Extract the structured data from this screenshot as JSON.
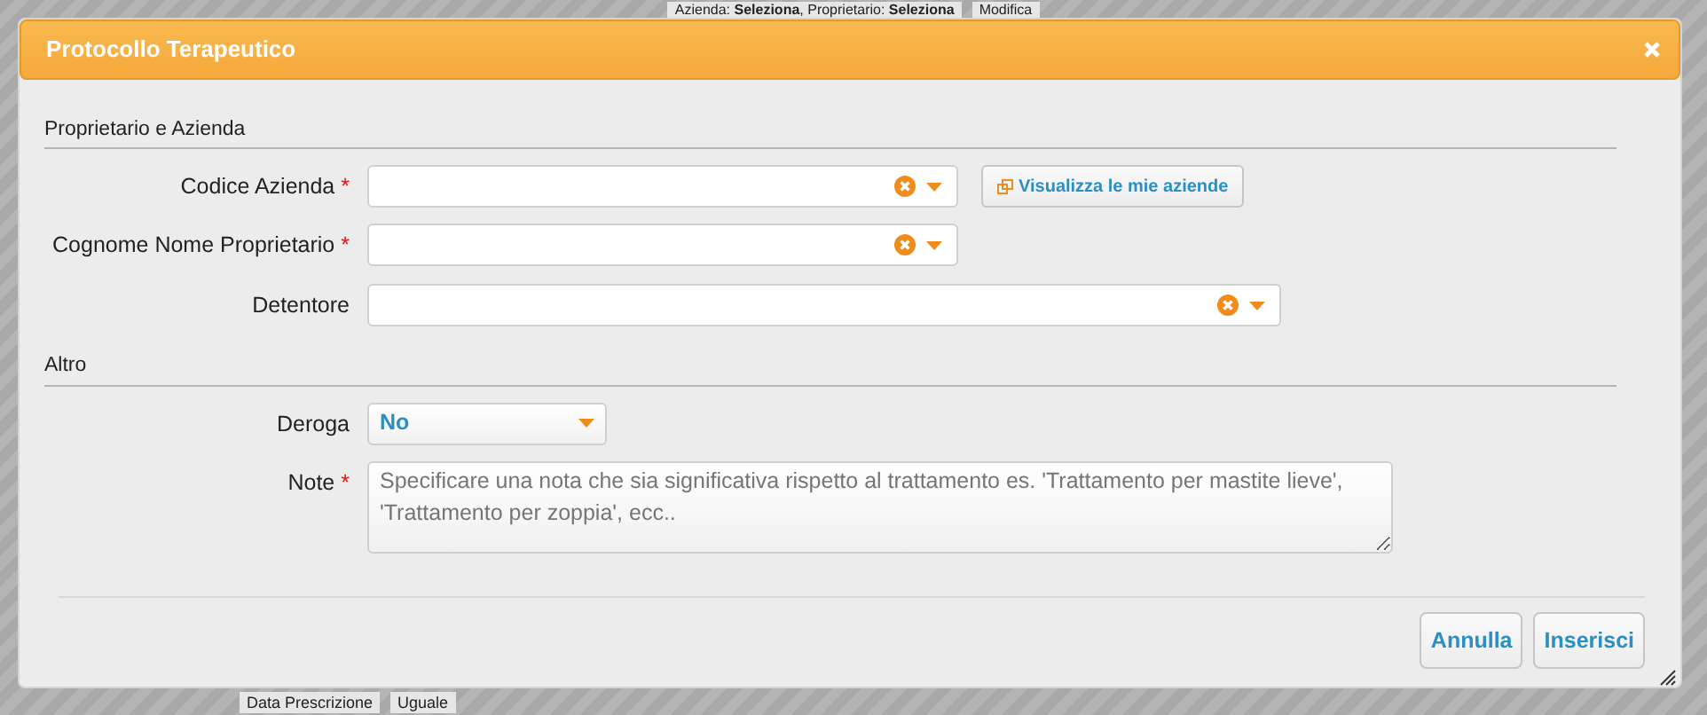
{
  "background_page": {
    "summary": "Azienda: **Seleziona**, Proprietario: **Seleziona**",
    "edit_link": "Modifica",
    "filter_label": "Data Prescrizione",
    "filter_value": "Uguale"
  },
  "dialog": {
    "title": "Protocollo Terapeutico",
    "sections": [
      {
        "title": "Proprietario e Azienda",
        "fields": [
          {
            "kind": "combo",
            "label": "Codice Azienda",
            "required_mark": "*",
            "action_button": "Visualizza le mie aziende"
          },
          {
            "kind": "combo",
            "label": "Cognome Nome Proprietario",
            "required_mark": "*"
          },
          {
            "kind": "combo",
            "label": "Detentore"
          }
        ]
      },
      {
        "title": "Altro",
        "fields": [
          {
            "kind": "select",
            "label": "Deroga",
            "value": "No"
          },
          {
            "kind": "textarea",
            "label": "Note",
            "required_mark": "*",
            "placeholder": "Specificare una nota che sia significativa rispetto al trattamento es. 'Trattamento per mastite lieve', 'Trattamento per zoppia', ecc.."
          }
        ]
      }
    ],
    "buttons": [
      "Annulla",
      "Inserisci"
    ]
  }
}
